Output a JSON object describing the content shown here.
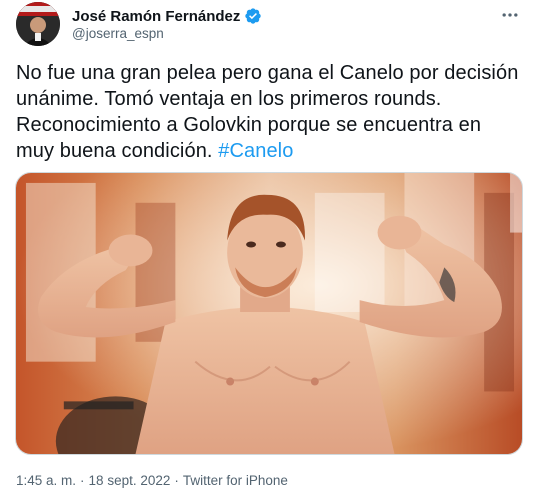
{
  "author": {
    "display_name": "José Ramón Fernández",
    "handle": "@joserra_espn",
    "verified": true
  },
  "tweet": {
    "text_lines": [
      "No fue una gran pelea pero gana el Canelo por decisión",
      "unánime. Tomó ventaja en los primeros rounds.",
      "Reconocimiento a Golovkin porque se encuentra en",
      "muy buena condición."
    ],
    "hashtag": "#Canelo"
  },
  "footer": {
    "time": "1:45 a. m.",
    "separator": "·",
    "date": "18 sept. 2022",
    "source": "Twitter for iPhone"
  },
  "icons": {
    "more": "more-horizontal-icon",
    "verified": "verified-badge-icon"
  },
  "colors": {
    "link": "#1d9bf0",
    "secondary_text": "#536471",
    "primary_text": "#0f1419",
    "verified": "#1d9bf0"
  }
}
